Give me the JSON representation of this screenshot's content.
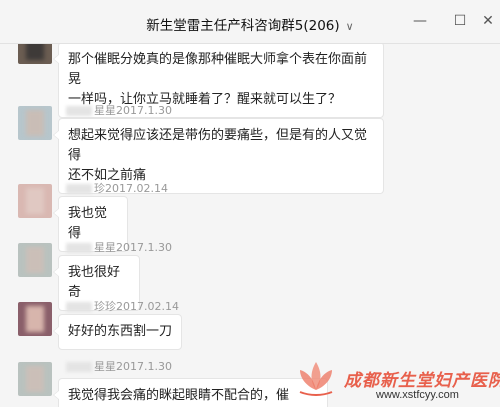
{
  "window": {
    "title": "新生堂雷主任产科咨询群5",
    "member_count": "(206)",
    "chevron_icon": "chevron-down-icon",
    "minimize_label": "—",
    "maximize_label": "☐",
    "close_label": "✕"
  },
  "messages": [
    {
      "sender": "",
      "time": "",
      "lines": [
        "那个催眠分娩真的是像那种催眠大师拿个表在你面前晃",
        "一样吗，让你立马就睡着了？醒来就可以生了？"
      ]
    },
    {
      "sender": "星星",
      "time": "2017.1.30",
      "lines": [
        "想起来觉得应该还是带伤的要痛些，但是有的人又觉得",
        "还不如之前痛"
      ]
    },
    {
      "sender": "珍",
      "time": "2017.02.14",
      "lines": [
        "我也觉得"
      ]
    },
    {
      "sender": "星星",
      "time": "2017.1.30",
      "lines": [
        "我也很好奇"
      ]
    },
    {
      "sender": "珍珍",
      "time": "2017.02.14",
      "lines": [
        "好好的东西割一刀"
      ]
    },
    {
      "sender": "星星",
      "time": "2017.1.30",
      "lines": [
        "我觉得我会痛的眯起眼睛不配合的，催"
      ]
    }
  ],
  "watermark": {
    "name": "成都新生堂妇产医院",
    "url": "www.xstfcyy.com",
    "color": "#e8604c"
  }
}
